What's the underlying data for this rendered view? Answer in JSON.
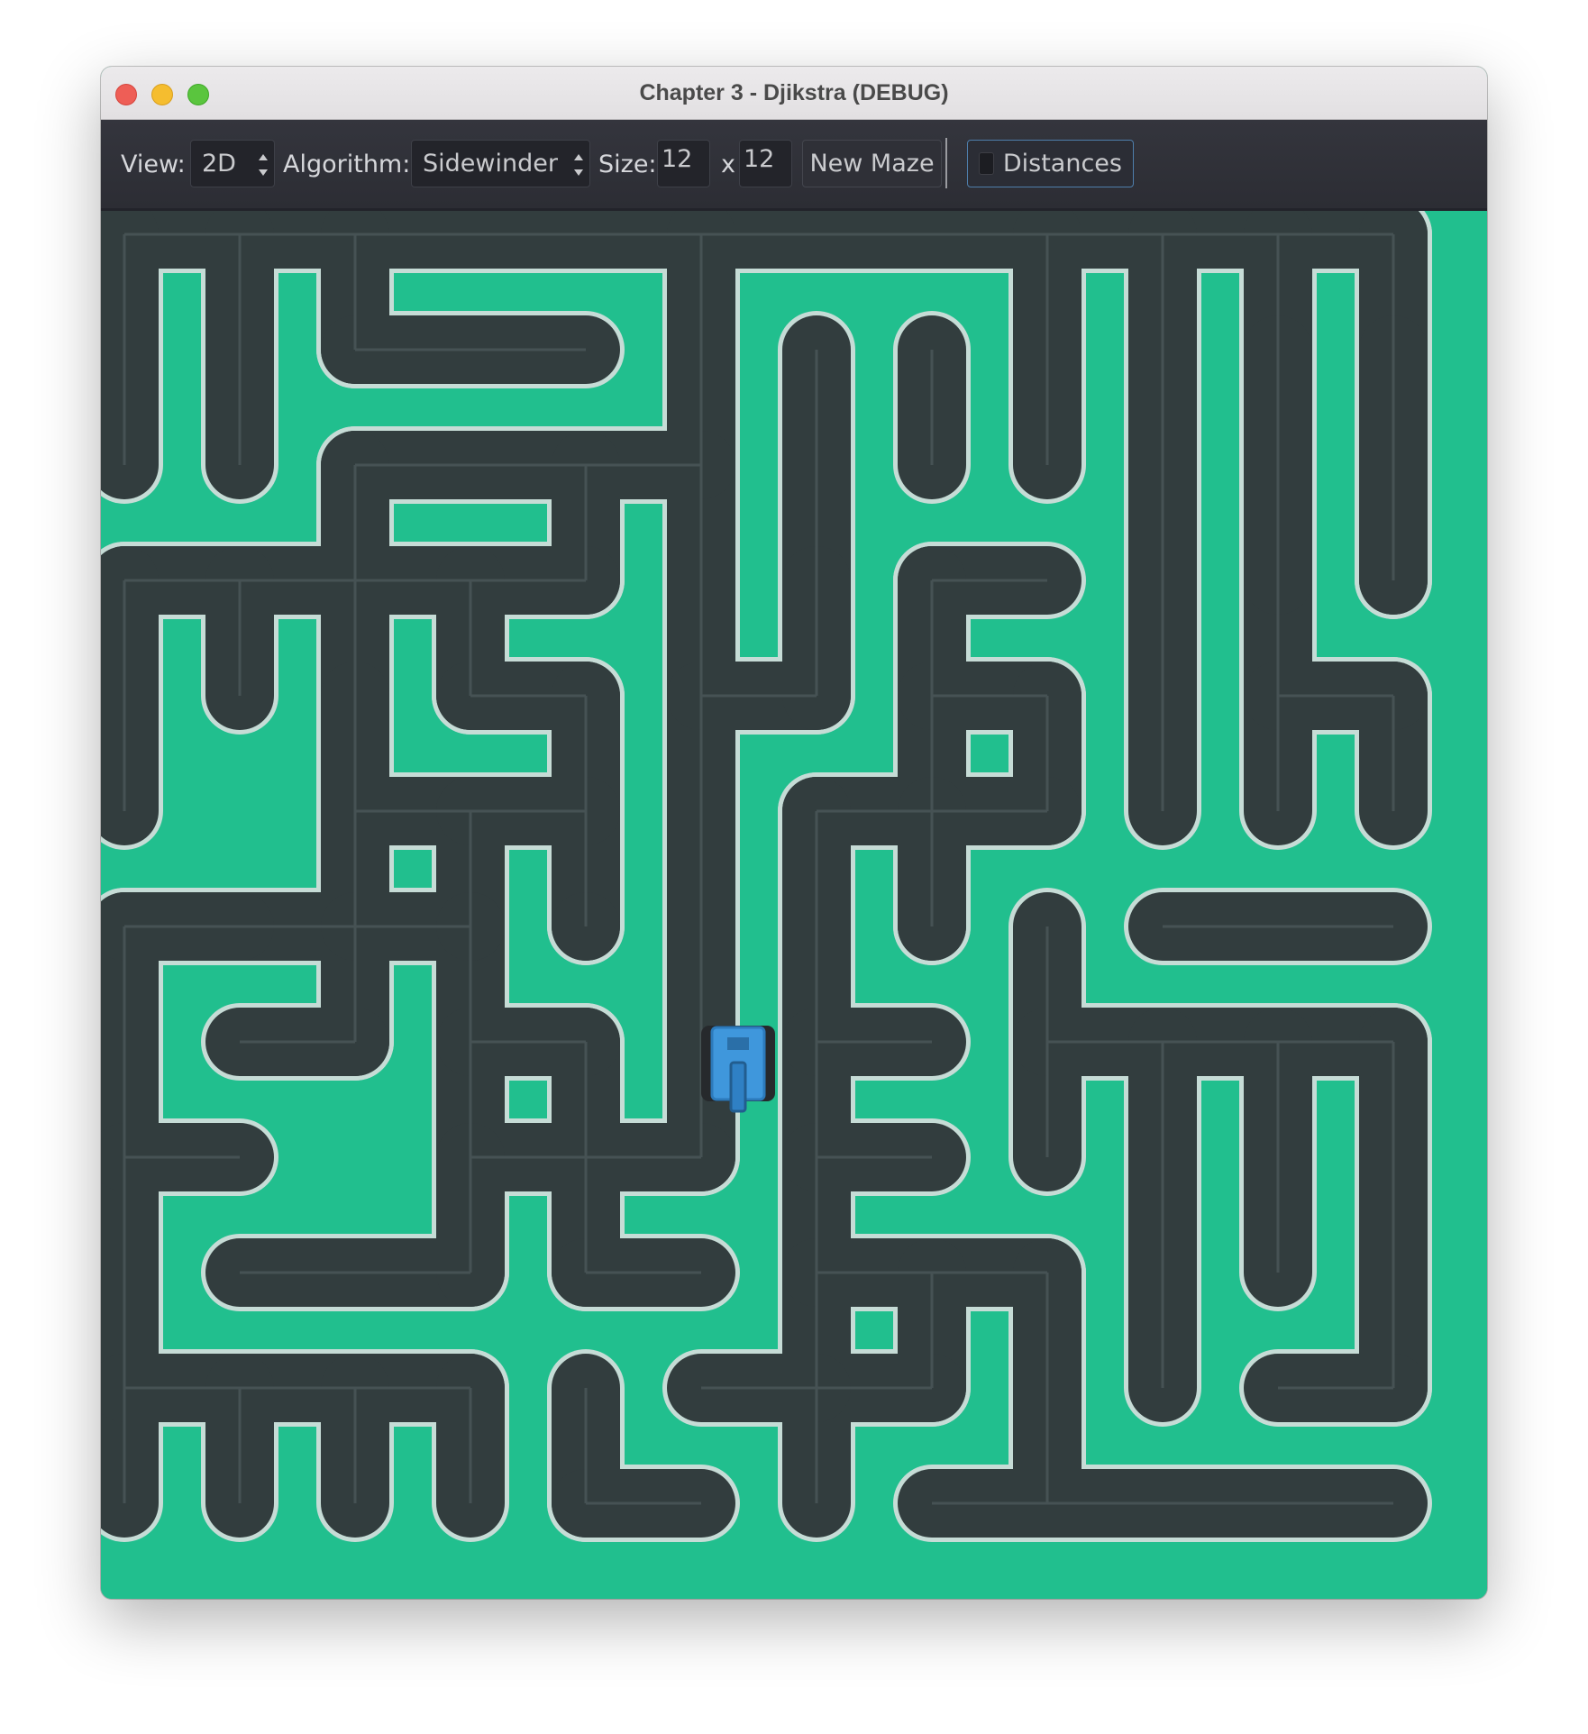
{
  "window": {
    "title": "Chapter 3 - Djikstra (DEBUG)"
  },
  "toolbar": {
    "view_label": "View:",
    "view_value": "2D",
    "algorithm_label": "Algorithm:",
    "algorithm_value": "Sidewinder",
    "size_label": "Size:",
    "size_width": "12",
    "size_separator": "x",
    "size_height": "12",
    "new_maze_label": "New Maze",
    "distances_label": "Distances",
    "distances_checked": false
  },
  "maze": {
    "rows": 12,
    "cols": 12,
    "colors": {
      "background": "#21bf8e",
      "road": "#323d3e",
      "road_outline": "#c6dcd6",
      "center_line": "#465254",
      "tank": "#3f97dc"
    }
  }
}
